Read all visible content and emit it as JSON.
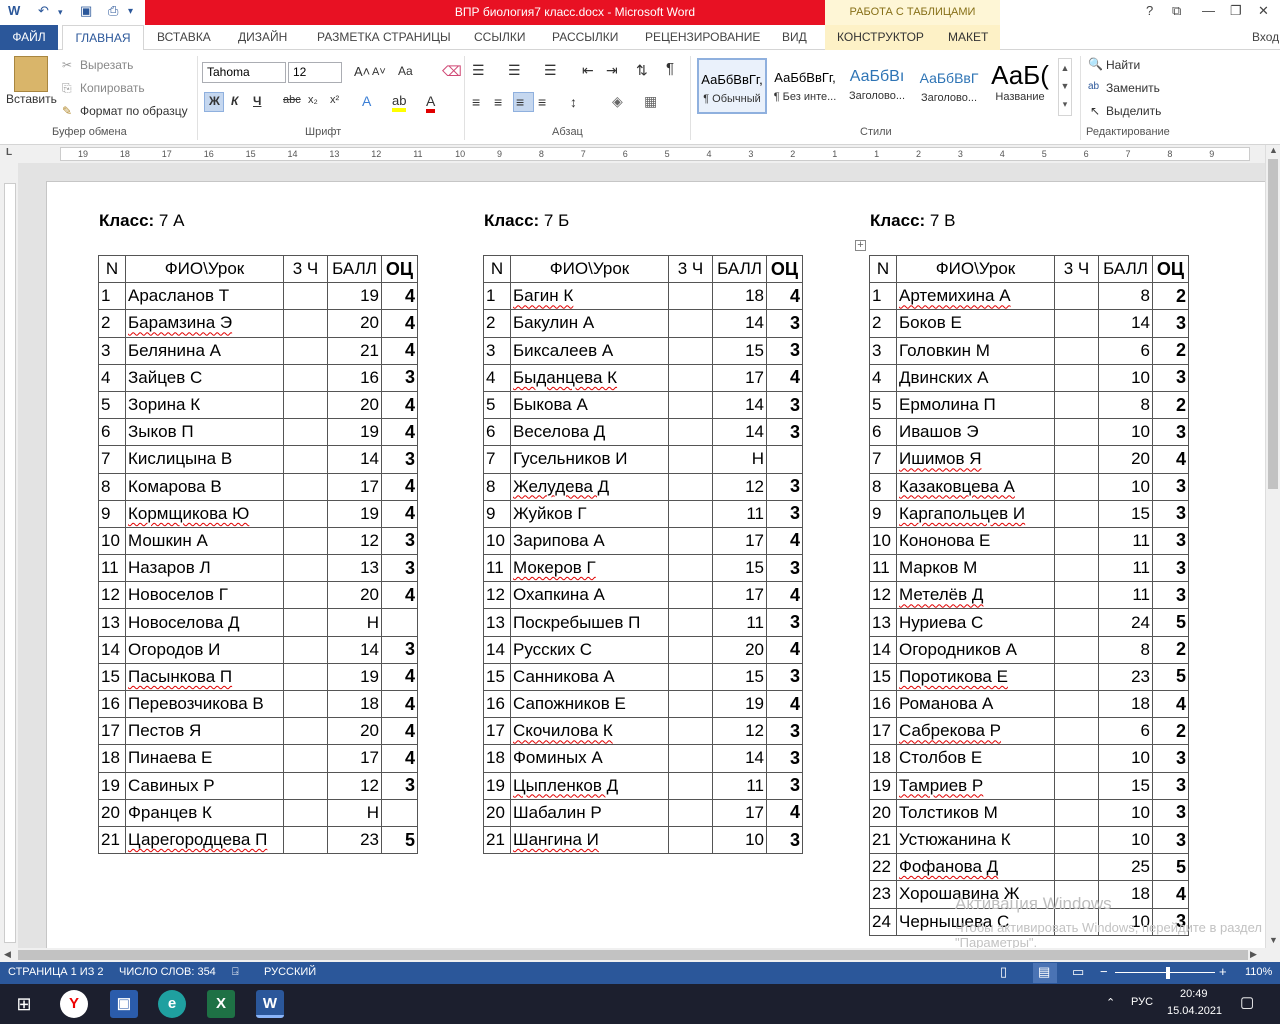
{
  "window": {
    "title": "ВПР  биология7 класс.docx  -  Microsoft Word",
    "table_tools": "РАБОТА С ТАБЛИЦАМИ",
    "help": "?"
  },
  "tabs": {
    "file": "ФАЙЛ",
    "home": "ГЛАВНАЯ",
    "insert": "ВСТАВКА",
    "design": "ДИЗАЙН",
    "layout": "РАЗМЕТКА СТРАНИЦЫ",
    "refs": "ССЫЛКИ",
    "mail": "РАССЫЛКИ",
    "review": "РЕЦЕНЗИРОВАНИЕ",
    "view": "ВИД",
    "constructor": "КОНСТРУКТОР",
    "maket": "МАКЕТ",
    "signin": "Вход"
  },
  "ribbon": {
    "clipboard": {
      "paste": "Вставить",
      "cut": "Вырезать",
      "copy": "Копировать",
      "format": "Формат по образцу",
      "label": "Буфер обмена"
    },
    "font": {
      "name": "Tahoma",
      "size": "12",
      "label": "Шрифт",
      "case": "Aa"
    },
    "paragraph": {
      "label": "Абзац"
    },
    "styles": {
      "label": "Стили",
      "items": [
        {
          "sample": "АаБбВвГг,",
          "name": "¶ Обычный"
        },
        {
          "sample": "АаБбВвГг,",
          "name": "¶ Без инте..."
        },
        {
          "sample": "АаБбВı",
          "name": "Заголово..."
        },
        {
          "sample": "АаБбВвГ",
          "name": "Заголово..."
        },
        {
          "sample": "АаБ(",
          "name": "Название"
        }
      ]
    },
    "editing": {
      "find": "Найти",
      "replace": "Заменить",
      "select": "Выделить",
      "label": "Редактирование"
    }
  },
  "ruler": {
    "numbers": [
      "19",
      "18",
      "17",
      "16",
      "15",
      "14",
      "13",
      "12",
      "11",
      "10",
      "9",
      "8",
      "7",
      "6",
      "5",
      "4",
      "3",
      "2",
      "1",
      "1",
      "2",
      "3",
      "4",
      "5",
      "6",
      "7",
      "8",
      "9"
    ]
  },
  "tables": [
    {
      "heading_label": "Класс:",
      "heading_value": " 7 А",
      "headers": [
        "N",
        "ФИО\\Урок",
        "3 Ч",
        "БАЛЛ",
        "ОЦ"
      ],
      "rows": [
        [
          "1",
          "Арасланов Т",
          "",
          "19",
          "4"
        ],
        [
          "2",
          "Барамзина Э",
          "",
          "20",
          "4"
        ],
        [
          "3",
          "Белянина А",
          "",
          "21",
          "4"
        ],
        [
          "4",
          "Зайцев С",
          "",
          "16",
          "3"
        ],
        [
          "5",
          "Зорина К",
          "",
          "20",
          "4"
        ],
        [
          "6",
          "Зыков П",
          "",
          "19",
          "4"
        ],
        [
          "7",
          "Кислицына В",
          "",
          "14",
          "3"
        ],
        [
          "8",
          "Комарова В",
          "",
          "17",
          "4"
        ],
        [
          "9",
          "Кормщикова Ю",
          "",
          "19",
          "4"
        ],
        [
          "10",
          "Мошкин А",
          "",
          "12",
          "3"
        ],
        [
          "11",
          "Назаров Л",
          "",
          "13",
          "3"
        ],
        [
          "12",
          "Новоселов Г",
          "",
          "20",
          "4"
        ],
        [
          "13",
          "Новоселова Д",
          "",
          "Н",
          ""
        ],
        [
          "14",
          "Огородов И",
          "",
          "14",
          "3"
        ],
        [
          "15",
          "Пасынкова П",
          "",
          "19",
          "4"
        ],
        [
          "16",
          "Перевозчикова В",
          "",
          "18",
          "4"
        ],
        [
          "17",
          "Пестов Я",
          "",
          "20",
          "4"
        ],
        [
          "18",
          "Пинаева Е",
          "",
          "17",
          "4"
        ],
        [
          "19",
          "Савиных Р",
          "",
          "12",
          "3"
        ],
        [
          "20",
          "Францев К",
          "",
          "Н",
          ""
        ],
        [
          "21",
          "Царегородцева П",
          "",
          "23",
          "5"
        ]
      ]
    },
    {
      "heading_label": "Класс:",
      "heading_value": " 7 Б",
      "headers": [
        "N",
        "ФИО\\Урок",
        "3 Ч",
        "БАЛЛ",
        "ОЦ"
      ],
      "rows": [
        [
          "1",
          "Багин К",
          "",
          "18",
          "4"
        ],
        [
          "2",
          "Бакулин А",
          "",
          "14",
          "3"
        ],
        [
          "3",
          "Биксалеев А",
          "",
          "15",
          "3"
        ],
        [
          "4",
          "Быданцева К",
          "",
          "17",
          "4"
        ],
        [
          "5",
          "Быкова А",
          "",
          "14",
          "3"
        ],
        [
          "6",
          "Веселова Д",
          "",
          "14",
          "3"
        ],
        [
          "7",
          "Гусельников И",
          "",
          "Н",
          ""
        ],
        [
          "8",
          "Желудева Д",
          "",
          "12",
          "3"
        ],
        [
          "9",
          "Жуйков Г",
          "",
          "11",
          "3"
        ],
        [
          "10",
          "Зарипова А",
          "",
          "17",
          "4"
        ],
        [
          "11",
          "Мокеров Г",
          "",
          "15",
          "3"
        ],
        [
          "12",
          "Охапкина А",
          "",
          "17",
          "4"
        ],
        [
          "13",
          "Поскребышев П",
          "",
          "11",
          "3"
        ],
        [
          "14",
          "Русских С",
          "",
          "20",
          "4"
        ],
        [
          "15",
          "Санникова А",
          "",
          "15",
          "3"
        ],
        [
          "16",
          "Сапожников Е",
          "",
          "19",
          "4"
        ],
        [
          "17",
          "Скочилова К",
          "",
          "12",
          "3"
        ],
        [
          "18",
          "Фоминых А",
          "",
          "14",
          "3"
        ],
        [
          "19",
          "Цыпленков Д",
          "",
          "11",
          "3"
        ],
        [
          "20",
          "Шабалин Р",
          "",
          "17",
          "4"
        ],
        [
          "21",
          "Шангина И",
          "",
          "10",
          "3"
        ]
      ]
    },
    {
      "heading_label": "Класс:",
      "heading_value": " 7 В",
      "headers": [
        "N",
        "ФИО\\Урок",
        "3 Ч",
        "БАЛЛ",
        "ОЦ"
      ],
      "rows": [
        [
          "1",
          "Артемихина А",
          "",
          "8",
          "2"
        ],
        [
          "2",
          "Боков Е",
          "",
          "14",
          "3"
        ],
        [
          "3",
          "Головкин М",
          "",
          "6",
          "2"
        ],
        [
          "4",
          "Двинских А",
          "",
          "10",
          "3"
        ],
        [
          "5",
          "Ермолина П",
          "",
          "8",
          "2"
        ],
        [
          "6",
          "Ивашов Э",
          "",
          "10",
          "3"
        ],
        [
          "7",
          "Ишимов Я",
          "",
          "20",
          "4"
        ],
        [
          "8",
          "Казаковцева А",
          "",
          "10",
          "3"
        ],
        [
          "9",
          "Каргапольцев И",
          "",
          "15",
          "3"
        ],
        [
          "10",
          "Кононова Е",
          "",
          "11",
          "3"
        ],
        [
          "11",
          "Марков М",
          "",
          "11",
          "3"
        ],
        [
          "12",
          "Метелёв Д",
          "",
          "11",
          "3"
        ],
        [
          "13",
          "Нуриева С",
          "",
          "24",
          "5"
        ],
        [
          "14",
          "Огородников А",
          "",
          "8",
          "2"
        ],
        [
          "15",
          "Поротикова Е",
          "",
          "23",
          "5"
        ],
        [
          "16",
          "Романова А",
          "",
          "18",
          "4"
        ],
        [
          "17",
          "Сабрекова Р",
          "",
          "6",
          "2"
        ],
        [
          "18",
          "Столбов Е",
          "",
          "10",
          "3"
        ],
        [
          "19",
          "Тамриев Р",
          "",
          "15",
          "3"
        ],
        [
          "20",
          "Толстиков М",
          "",
          "10",
          "3"
        ],
        [
          "21",
          "Устюжанина К",
          "",
          "10",
          "3"
        ],
        [
          "22",
          "Фофанова Д",
          "",
          "25",
          "5"
        ],
        [
          "23",
          "Хорошавина Ж",
          "",
          "18",
          "4"
        ],
        [
          "24",
          "Чернышева С",
          "",
          "10",
          "3"
        ]
      ]
    }
  ],
  "watermark": {
    "line1": "Активация Windows",
    "line2": "Чтобы активировать Windows, перейдите в раздел \"Параметры\"."
  },
  "status": {
    "page": "СТРАНИЦА 1 ИЗ 2",
    "words": "ЧИСЛО СЛОВ: 354",
    "lang": "РУССКИЙ",
    "zoom": "110%"
  },
  "taskbar": {
    "lang": "РУС",
    "time": "20:49",
    "date": "15.04.2021"
  }
}
